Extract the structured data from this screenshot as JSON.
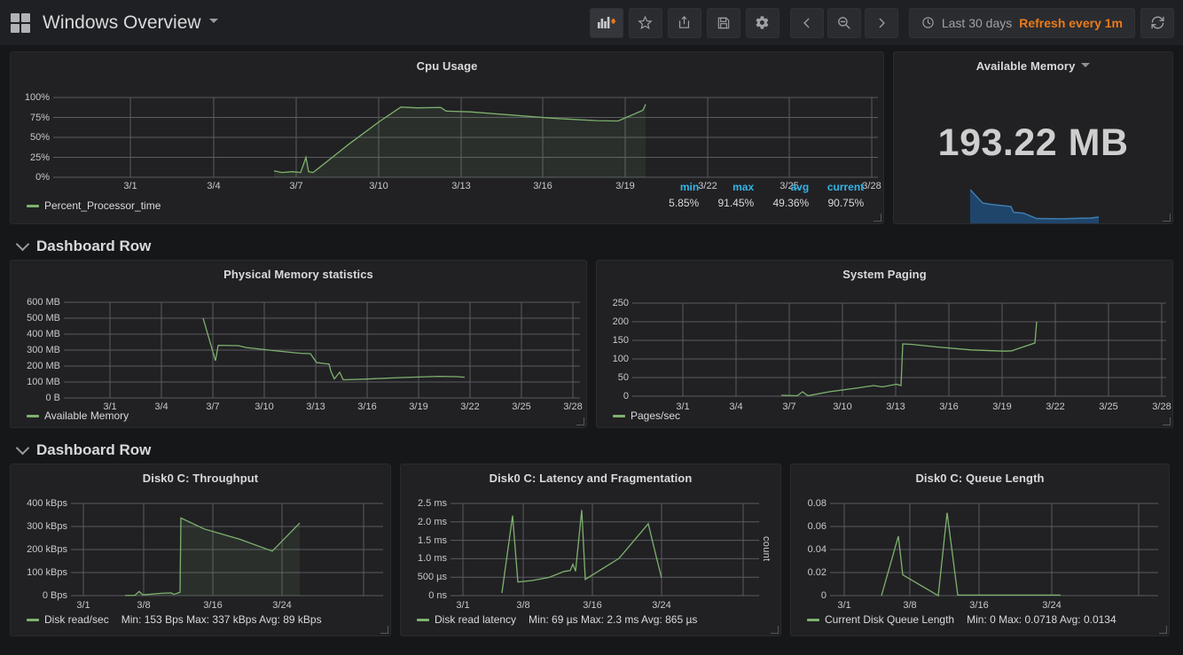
{
  "navbar": {
    "title": "Windows Overview",
    "logo_icon": "dashboard-grid-icon",
    "title_caret_icon": "chevron-down-icon",
    "buttons": [
      {
        "name": "add-panel-button",
        "icon": "add-panel-icon",
        "label": ""
      },
      {
        "name": "star-button",
        "icon": "star-icon",
        "label": ""
      },
      {
        "name": "share-button",
        "icon": "share-icon",
        "label": ""
      },
      {
        "name": "save-button",
        "icon": "save-floppy-icon",
        "label": ""
      },
      {
        "name": "settings-button",
        "icon": "gear-icon",
        "label": ""
      }
    ],
    "nav_buttons": [
      {
        "name": "time-shift-back-button",
        "icon": "chevron-left-icon"
      },
      {
        "name": "zoom-out-button",
        "icon": "magnifier-minus-icon"
      },
      {
        "name": "time-shift-forward-button",
        "icon": "chevron-right-icon"
      }
    ],
    "timepicker": {
      "clock_icon": "clock-icon",
      "range": "Last 30 days",
      "refresh": "Refresh every 1m"
    },
    "refresh_button": {
      "name": "refresh-button",
      "icon": "refresh-icon"
    }
  },
  "rows": [
    {
      "name": "row-1",
      "title": "Dashboard Row",
      "collapse_icon": "chevron-down-icon"
    },
    {
      "name": "row-2",
      "title": "Dashboard Row",
      "collapse_icon": "chevron-down-icon"
    }
  ],
  "panels": {
    "cpu_usage": {
      "title": "Cpu Usage",
      "legend": "Percent_Processor_time",
      "stats": [
        {
          "label": "min",
          "value": "5.85%"
        },
        {
          "label": "max",
          "value": "91.45%"
        },
        {
          "label": "avg",
          "value": "49.36%"
        },
        {
          "label": "current",
          "value": "90.75%"
        }
      ]
    },
    "available_memory": {
      "title": "Available Memory",
      "menu_icon": "chevron-down-icon",
      "value": "193.22 MB"
    },
    "physical_memory": {
      "title": "Physical Memory statistics",
      "legend": "Available Memory"
    },
    "system_paging": {
      "title": "System Paging",
      "legend": "Pages/sec"
    },
    "disk_throughput": {
      "title": "Disk0 C: Throughput",
      "legend": "Disk read/sec",
      "stats": "Min: 153 Bps   Max: 337 kBps   Avg: 89 kBps"
    },
    "disk_latency": {
      "title": "Disk0 C: Latency and Fragmentation",
      "legend": "Disk read latency",
      "stats": "Min: 69 µs   Max: 2.3 ms   Avg: 865 µs",
      "right_axis_title": "count"
    },
    "disk_queue": {
      "title": "Disk0 C: Queue Length",
      "legend": "Current Disk Queue Length",
      "stats": "Min: 0   Max: 0.0718   Avg: 0.0134"
    }
  },
  "colors": {
    "series_green": "#7eb26d",
    "series_blue": "#3f7fb0",
    "stat_label_blue": "#33b5e5",
    "refresh_orange": "#eb7b18",
    "panel_bg": "#212124",
    "page_bg": "#161719"
  },
  "chart_data": [
    {
      "id": "cpu_usage",
      "type": "line",
      "title": "Cpu Usage",
      "xlabel": "",
      "ylabel": "",
      "ylim": [
        0,
        100
      ],
      "yticks": [
        "0%",
        "25%",
        "50%",
        "75%",
        "100%"
      ],
      "yvalues": [
        0,
        25,
        50,
        75,
        100
      ],
      "xticks": [
        "3/1",
        "3/4",
        "3/7",
        "3/10",
        "3/13",
        "3/16",
        "3/19",
        "3/22",
        "3/25",
        "3/28"
      ],
      "grid": true,
      "legend_position": "bottom-left",
      "series": [
        {
          "name": "Percent_Processor_time",
          "color": "#7eb26d",
          "fill": true,
          "points": [
            [
              6.7,
              8
            ],
            [
              7.0,
              6
            ],
            [
              7.4,
              6.5
            ],
            [
              7.7,
              6
            ],
            [
              7.9,
              25
            ],
            [
              8.0,
              7
            ],
            [
              8.15,
              6
            ],
            [
              8.4,
              12
            ],
            [
              9.5,
              42
            ],
            [
              10.6,
              70
            ],
            [
              11.4,
              88
            ],
            [
              12.0,
              87
            ],
            [
              12.9,
              87.5
            ],
            [
              13.1,
              83
            ],
            [
              14.0,
              82
            ],
            [
              15.5,
              78
            ],
            [
              17.0,
              74
            ],
            [
              18.6,
              71
            ],
            [
              19.4,
              70.5
            ],
            [
              20.3,
              84
            ],
            [
              20.4,
              91.45
            ]
          ]
        }
      ]
    },
    {
      "id": "available_memory",
      "type": "area",
      "title": "Available Memory",
      "display_value": "193.22 MB",
      "legend_position": "none",
      "grid": false,
      "series": [
        {
          "name": "Available Memory",
          "color": "#3f7fb0",
          "fill": true,
          "points": [
            [
              0,
              100
            ],
            [
              1.0,
              62
            ],
            [
              1.6,
              58
            ],
            [
              3.2,
              53
            ],
            [
              3.4,
              38
            ],
            [
              4.2,
              35
            ],
            [
              5.2,
              20
            ],
            [
              7.0,
              19
            ],
            [
              9.3,
              20
            ],
            [
              10.0,
              22
            ]
          ]
        }
      ]
    },
    {
      "id": "physical_memory",
      "type": "line",
      "title": "Physical Memory statistics",
      "ylim": [
        0,
        600
      ],
      "yticks": [
        "0 B",
        "100 MB",
        "200 MB",
        "300 MB",
        "400 MB",
        "500 MB",
        "600 MB"
      ],
      "yvalues": [
        0,
        100,
        200,
        300,
        400,
        500,
        600
      ],
      "xticks": [
        "3/1",
        "3/4",
        "3/7",
        "3/10",
        "3/13",
        "3/16",
        "3/19",
        "3/22",
        "3/25",
        "3/28"
      ],
      "grid": true,
      "legend_position": "bottom-left",
      "series": [
        {
          "name": "Available Memory",
          "color": "#7eb26d",
          "fill": false,
          "points": [
            [
              6.6,
              500
            ],
            [
              7.3,
              233
            ],
            [
              7.5,
              330
            ],
            [
              8.7,
              300
            ],
            [
              10.3,
              270
            ],
            [
              11.9,
              222
            ],
            [
              12.1,
              175
            ],
            [
              12.8,
              170
            ],
            [
              13.0,
              125
            ],
            [
              13.1,
              85
            ],
            [
              14.0,
              80
            ],
            [
              16.5,
              90
            ],
            [
              19.0,
              97
            ],
            [
              20.4,
              93
            ]
          ]
        }
      ]
    },
    {
      "id": "system_paging",
      "type": "line",
      "title": "System Paging",
      "ylim": [
        0,
        250
      ],
      "yticks": [
        "0",
        "50",
        "100",
        "150",
        "200",
        "250"
      ],
      "yvalues": [
        0,
        50,
        100,
        150,
        200,
        250
      ],
      "xticks": [
        "3/1",
        "3/4",
        "3/7",
        "3/10",
        "3/13",
        "3/16",
        "3/19",
        "3/22",
        "3/25",
        "3/28"
      ],
      "grid": true,
      "legend_position": "bottom-left",
      "series": [
        {
          "name": "Pages/sec",
          "color": "#7eb26d",
          "fill": false,
          "points": [
            [
              6.5,
              2
            ],
            [
              7.4,
              1
            ],
            [
              7.6,
              12
            ],
            [
              7.8,
              2
            ],
            [
              9.0,
              10
            ],
            [
              10.5,
              20
            ],
            [
              11.5,
              28
            ],
            [
              11.9,
              25
            ],
            [
              12.7,
              32
            ],
            [
              12.85,
              28
            ],
            [
              12.95,
              140
            ],
            [
              13.5,
              138
            ],
            [
              15.0,
              128
            ],
            [
              17.0,
              118
            ],
            [
              18.8,
              112
            ],
            [
              19.0,
              113
            ],
            [
              20.3,
              143
            ],
            [
              20.35,
              200
            ]
          ]
        }
      ]
    },
    {
      "id": "disk_throughput",
      "type": "line",
      "title": "Disk0 C: Throughput",
      "ylim": [
        0,
        400
      ],
      "yticks": [
        "0 Bps",
        "100 kBps",
        "200 kBps",
        "300 kBps",
        "400 kBps"
      ],
      "yvalues": [
        0,
        100,
        200,
        300,
        400
      ],
      "xticks": [
        "3/1",
        "3/8",
        "3/16",
        "3/24"
      ],
      "grid": true,
      "legend_position": "bottom-left",
      "legend_stats": "Min: 153 Bps   Max: 337 kBps   Avg: 89 kBps",
      "series": [
        {
          "name": "Disk read/sec",
          "color": "#7eb26d",
          "fill": true,
          "points": [
            [
              6.6,
              0.2
            ],
            [
              7.5,
              1
            ],
            [
              7.9,
              18
            ],
            [
              8.1,
              3
            ],
            [
              10.0,
              10
            ],
            [
              11.0,
              12
            ],
            [
              11.2,
              5
            ],
            [
              11.8,
              14
            ],
            [
              11.9,
              337
            ],
            [
              13.5,
              290
            ],
            [
              16.0,
              245
            ],
            [
              18.3,
              193
            ],
            [
              20.3,
              315
            ]
          ]
        }
      ]
    },
    {
      "id": "disk_latency",
      "type": "line",
      "title": "Disk0 C: Latency and Fragmentation",
      "ylim": [
        0,
        2.5
      ],
      "yticks": [
        "0 ns",
        "500 µs",
        "1.0 ms",
        "1.5 ms",
        "2.0 ms",
        "2.5 ms"
      ],
      "yvalues": [
        0,
        0.5,
        1.0,
        1.5,
        2.0,
        2.5
      ],
      "xticks": [
        "3/1",
        "3/8",
        "3/16",
        "3/24"
      ],
      "right_axis_title": "count",
      "grid": true,
      "legend_position": "bottom-left",
      "legend_stats": "Min: 69 µs   Max: 2.3 ms   Avg: 865 µs",
      "series": [
        {
          "name": "Disk read latency",
          "color": "#7eb26d",
          "fill": false,
          "points": [
            [
              6.5,
              0.07
            ],
            [
              7.3,
              2.17
            ],
            [
              7.6,
              0.37
            ],
            [
              8.9,
              0.45
            ],
            [
              10.3,
              0.65
            ],
            [
              10.9,
              0.68
            ],
            [
              11.0,
              0.85
            ],
            [
              11.1,
              0.66
            ],
            [
              11.75,
              2.32
            ],
            [
              11.9,
              0.44
            ],
            [
              15.0,
              1.25
            ],
            [
              18.2,
              1.95
            ],
            [
              19.0,
              0.85
            ],
            [
              19.6,
              0.48
            ]
          ]
        }
      ]
    },
    {
      "id": "disk_queue",
      "type": "line",
      "title": "Disk0 C: Queue Length",
      "ylim": [
        0,
        0.08
      ],
      "yticks": [
        "0",
        "0.02",
        "0.04",
        "0.06",
        "0.08"
      ],
      "yvalues": [
        0,
        0.02,
        0.04,
        0.06,
        0.08
      ],
      "xticks": [
        "3/1",
        "3/8",
        "3/16",
        "3/24"
      ],
      "grid": true,
      "legend_position": "bottom-left",
      "legend_stats": "Min: 0   Max: 0.0718   Avg: 0.0134",
      "series": [
        {
          "name": "Current Disk Queue Length",
          "color": "#7eb26d",
          "fill": false,
          "points": [
            [
              6.6,
              0
            ],
            [
              7.5,
              0.0515
            ],
            [
              7.9,
              0.018
            ],
            [
              11.0,
              0
            ],
            [
              11.5,
              0.0718
            ],
            [
              12.0,
              0.0005
            ],
            [
              12.2,
              0.0005
            ],
            [
              12.3,
              0.0005
            ],
            [
              19.5,
              0.0005
            ]
          ]
        }
      ]
    }
  ]
}
